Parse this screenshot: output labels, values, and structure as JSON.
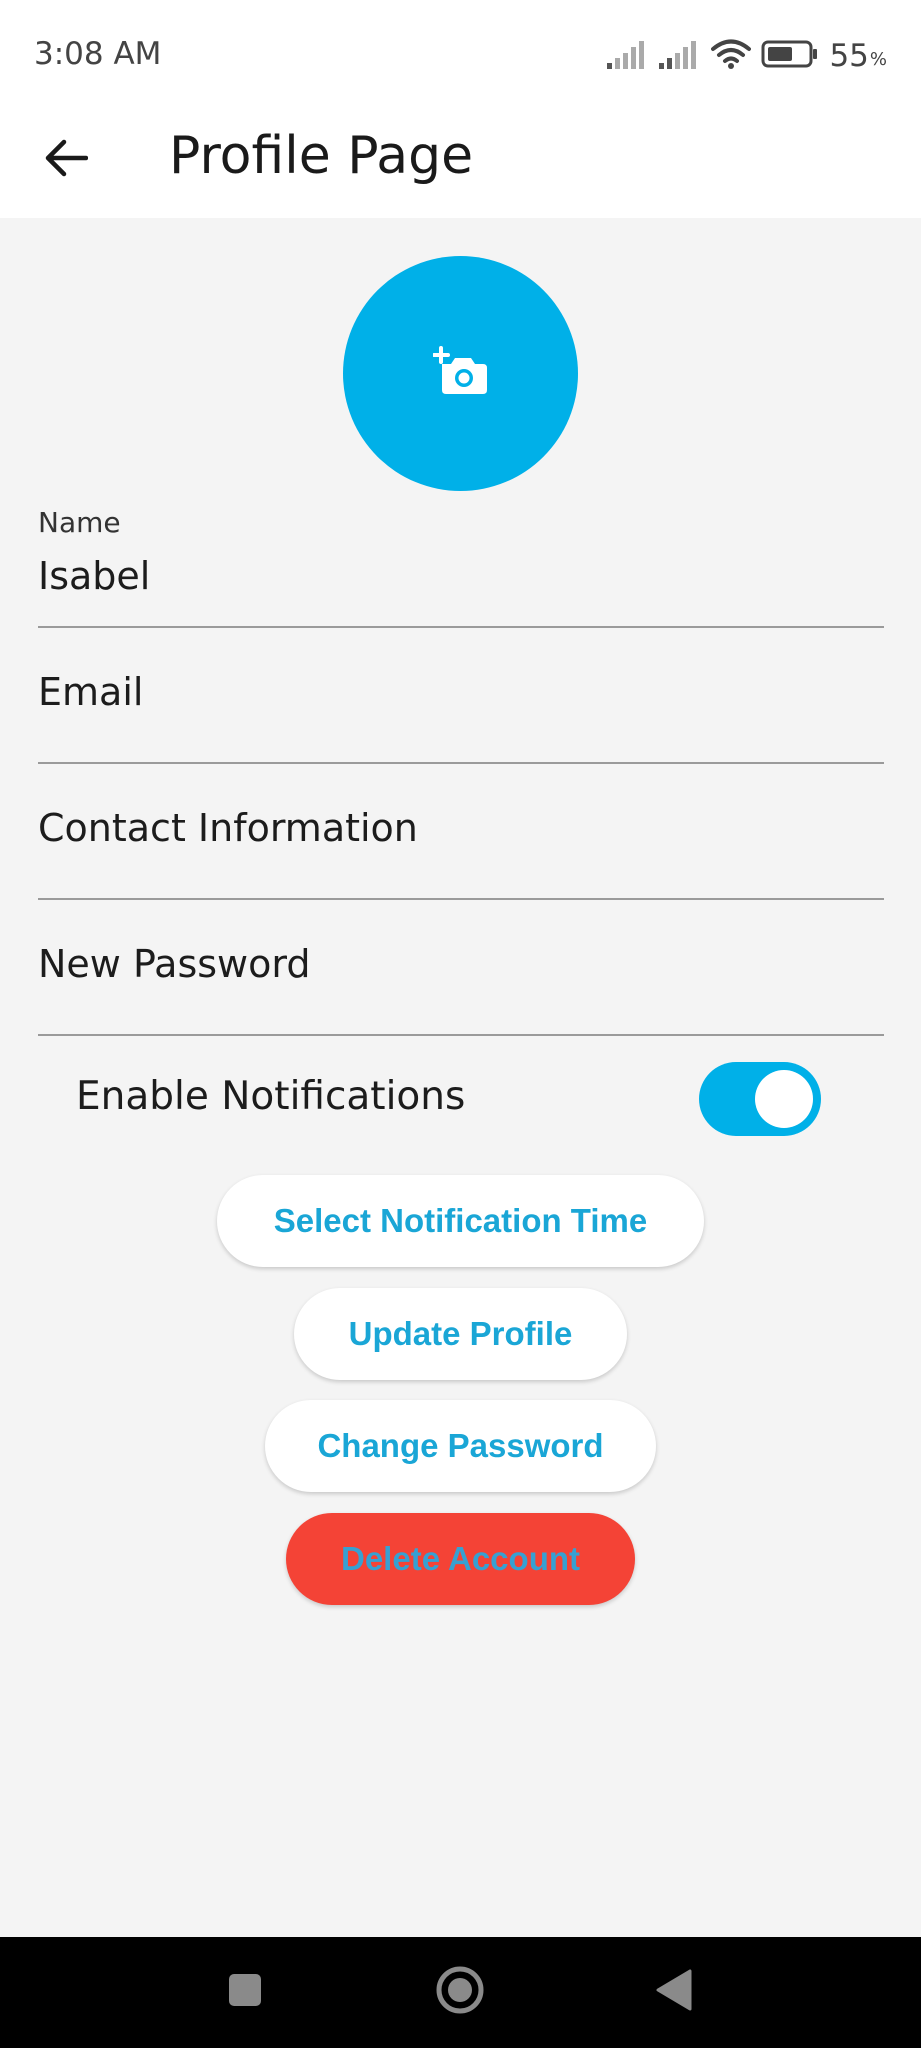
{
  "status_bar": {
    "time": "3:08 AM",
    "battery_level": "55",
    "battery_unit": "%",
    "icons": [
      "signal-1-icon",
      "signal-2-icon",
      "wifi-icon",
      "battery-icon"
    ]
  },
  "app_bar": {
    "title": "Profile Page",
    "back_icon": "back-arrow-icon"
  },
  "avatar": {
    "icon": "add-a-photo-icon",
    "color": "#00b0e8"
  },
  "form": {
    "name": {
      "label": "Name",
      "value": "Isabel"
    },
    "email": {
      "placeholder": "Email"
    },
    "contact": {
      "placeholder": "Contact Information"
    },
    "password": {
      "placeholder": "New Password"
    }
  },
  "notifications": {
    "label": "Enable Notifications",
    "enabled": true,
    "switch_color": "#00b0e8"
  },
  "actions": {
    "select_time": "Select Notification Time",
    "update_profile": "Update Profile",
    "change_password": "Change Password",
    "delete_account": "Delete Account",
    "accent_color": "#1aa6d6",
    "danger_color": "#f44336"
  },
  "nav_bar": {
    "icons": [
      "recents-square-icon",
      "home-circle-icon",
      "back-triangle-icon"
    ]
  }
}
